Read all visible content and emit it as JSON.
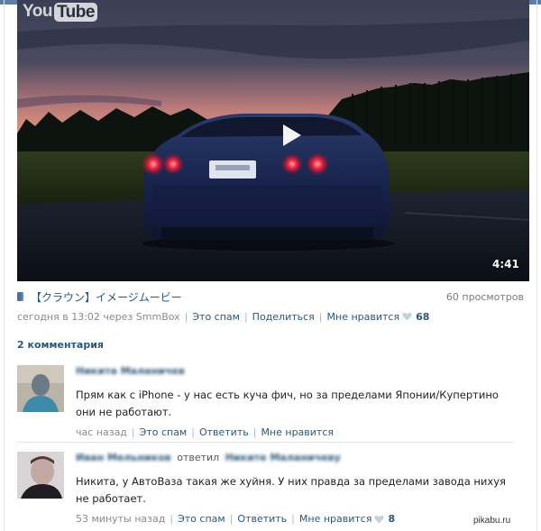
{
  "video": {
    "logo_you": "You",
    "logo_tube": "Tube",
    "duration": "4:41",
    "title": "【クラウン】イメージムービー",
    "views": "60 просмотров"
  },
  "meta": {
    "posted": "сегодня в 13:02 через SmmBox",
    "spam": "Это спам",
    "share": "Поделиться",
    "like": "Мне нравится",
    "like_count": "68"
  },
  "comments_header": "2 комментария",
  "comments": [
    {
      "author": "Никита Маланичев",
      "text": "Прям как с iPhone - у нас есть куча фич, но за пределами Японии/Купертино они не работают.",
      "time": "час назад",
      "spam": "Это спам",
      "reply": "Ответить",
      "like": "Мне нравится"
    },
    {
      "author": "Иван Мельников",
      "replied": "ответил",
      "reply_to": "Никите Маланичеву",
      "text": "Никита, у АвтоВаза такая же хуйня. У них правда за пределами завода нихуя не работает.",
      "time": "53 минуты назад",
      "spam": "Это спам",
      "reply": "Ответить",
      "like": "Мне нравится",
      "like_count": "8"
    }
  ],
  "watermark": "pikabu.ru",
  "colors": {
    "link": "#2b587a",
    "muted": "#8a8a8a",
    "accent_strip": "#5b7fa6"
  }
}
